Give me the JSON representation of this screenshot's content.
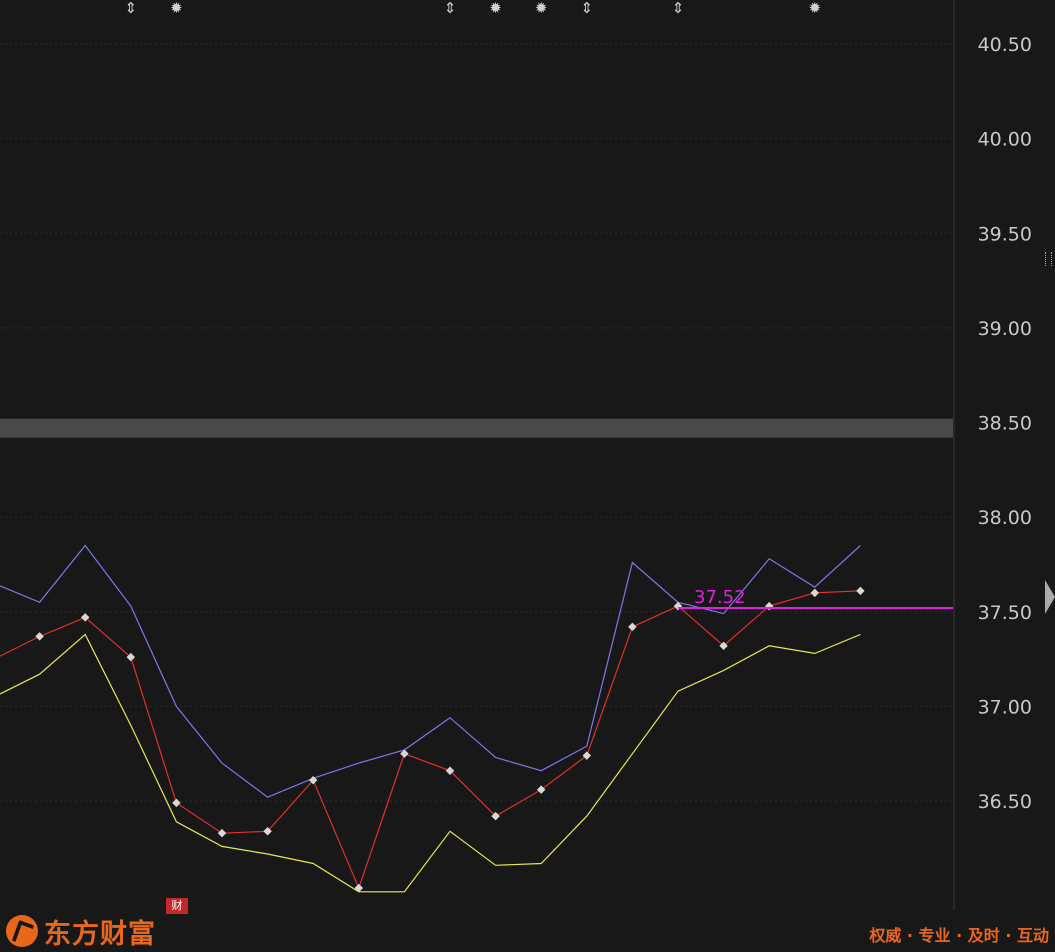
{
  "chart_data": {
    "type": "line",
    "ylim": [
      36.0,
      40.7
    ],
    "yticks": [
      "40.50",
      "40.00",
      "39.50",
      "39.00",
      "38.50",
      "38.00",
      "37.50",
      "37.00",
      "36.50"
    ],
    "ytick_values": [
      40.5,
      40.0,
      39.5,
      39.0,
      38.5,
      38.0,
      37.5,
      37.0,
      36.5
    ],
    "grid": true,
    "x_count": 19,
    "series": [
      {
        "key": "upper",
        "color": "#7a78e8",
        "values": [
          37.65,
          37.55,
          37.85,
          37.53,
          37.0,
          36.7,
          36.52,
          36.62,
          36.7,
          36.77,
          36.94,
          36.73,
          36.66,
          36.79,
          37.76,
          37.55,
          37.49,
          37.78,
          37.63,
          37.85
        ]
      },
      {
        "key": "middle",
        "color": "#e03030",
        "markers": true,
        "values": [
          37.25,
          37.37,
          37.47,
          37.26,
          36.49,
          36.33,
          36.34,
          36.61,
          36.04,
          36.75,
          36.66,
          36.42,
          36.56,
          36.74,
          37.42,
          37.53,
          37.32,
          37.53,
          37.6,
          37.61
        ]
      },
      {
        "key": "lower",
        "color": "#e8e850",
        "values": [
          37.05,
          37.17,
          37.38,
          36.9,
          36.39,
          36.26,
          36.22,
          36.17,
          36.02,
          36.02,
          36.34,
          36.16,
          36.17,
          36.42,
          36.75,
          37.08,
          37.19,
          37.32,
          37.28,
          37.38
        ]
      }
    ],
    "horizontal_line": {
      "value": 37.52,
      "label": "37.52",
      "color": "#e020e0"
    },
    "band": {
      "from": 38.42,
      "to": 38.52,
      "color": "#4a4a4a"
    },
    "event_markers": [
      {
        "index": 3,
        "symbol": "⇕"
      },
      {
        "index": 4,
        "symbol": "✹"
      },
      {
        "index": 10,
        "symbol": "⇕"
      },
      {
        "index": 11,
        "symbol": "✹"
      },
      {
        "index": 12,
        "symbol": "✹"
      },
      {
        "index": 13,
        "symbol": "⇕"
      },
      {
        "index": 15,
        "symbol": "⇕"
      },
      {
        "index": 18,
        "symbol": "✹"
      }
    ]
  },
  "badge": {
    "text": "财"
  },
  "brand": {
    "name": "东方财富",
    "slogan": "权威 · 专业 · 及时 · 互动"
  }
}
